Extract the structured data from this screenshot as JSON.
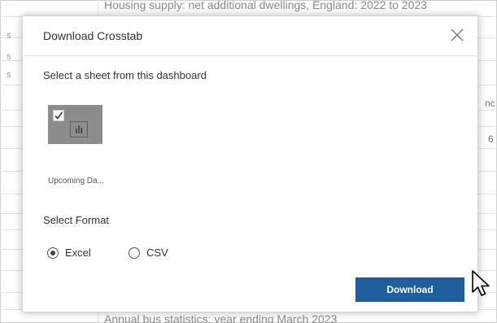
{
  "background": {
    "top_text": "Housing supply: net additional dwellings, England: 2022 to 2023",
    "bottom_text": "Annual bus statistics: year ending March 2023",
    "left_fragments": [
      "s",
      "s",
      "s"
    ],
    "right_fragments": [
      "nc",
      "6"
    ]
  },
  "dialog": {
    "title": "Download Crosstab",
    "close_icon": "close-icon",
    "sheet_prompt": "Select a sheet from this dashboard",
    "sheets": [
      {
        "name": "Upcoming Da...",
        "checked": true,
        "icon": "bar-chart-icon"
      }
    ],
    "format_label": "Select Format",
    "formats": [
      {
        "label": "Excel",
        "selected": true
      },
      {
        "label": "CSV",
        "selected": false
      }
    ],
    "download_label": "Download"
  },
  "colors": {
    "accent": "#1f5f9e",
    "thumbnail": "#8c8c8c"
  }
}
